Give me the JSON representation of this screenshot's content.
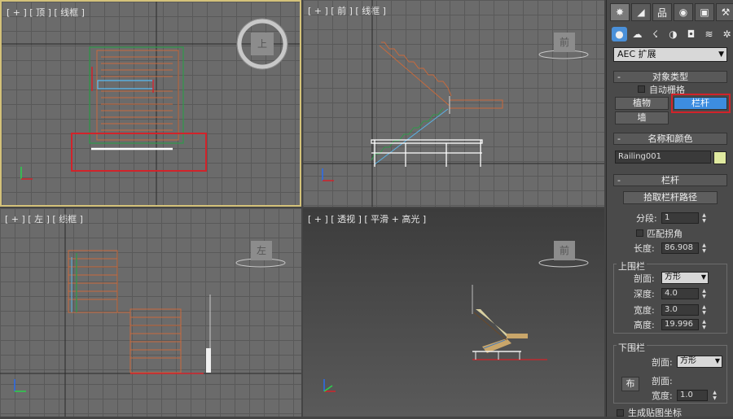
{
  "viewports": {
    "top": {
      "label": "[ + ] [ 顶 ] [ 线框 ]",
      "cube": "上"
    },
    "front": {
      "label": "[ + ] [ 前 ] [ 线框 ]",
      "cube": "前"
    },
    "left": {
      "label": "[ + ] [ 左 ] [ 线框 ]",
      "cube": "左"
    },
    "perspective": {
      "label": "[ + ] [ 透视 ] [ 平滑 + 高光 ]",
      "cube": "前"
    }
  },
  "panel": {
    "tabs": [
      {
        "icon": "create-icon",
        "glyph": "✸"
      },
      {
        "icon": "modify-icon",
        "glyph": "◢"
      },
      {
        "icon": "hierarchy-icon",
        "glyph": "品"
      },
      {
        "icon": "motion-icon",
        "glyph": "◉"
      },
      {
        "icon": "display-icon",
        "glyph": "▣"
      },
      {
        "icon": "utilities-icon",
        "glyph": "⚒"
      }
    ],
    "subtabs": [
      {
        "icon": "geometry-icon",
        "glyph": "●"
      },
      {
        "icon": "shapes-icon",
        "glyph": "☁"
      },
      {
        "icon": "lights-icon",
        "glyph": "☇"
      },
      {
        "icon": "cameras-icon",
        "glyph": "◑"
      },
      {
        "icon": "helpers-icon",
        "glyph": "◘"
      },
      {
        "icon": "spacewarps-icon",
        "glyph": "≋"
      },
      {
        "icon": "systems-icon",
        "glyph": "✲"
      }
    ],
    "category": "AEC 扩展",
    "object_type": {
      "title": "对象类型",
      "auto_grid": "自动栅格",
      "buttons": {
        "plant": "植物",
        "railing": "栏杆",
        "wall": "墙"
      }
    },
    "name_color": {
      "title": "名称和颜色",
      "name": "Railing001",
      "color": "#e0eaa0"
    },
    "railing": {
      "title": "栏杆",
      "pick_path": "拾取栏杆路径",
      "segments_label": "分段:",
      "segments_value": "1",
      "match_corners": "匹配拐角",
      "length_label": "长度:",
      "length_value": "86.908",
      "top_rail": {
        "title": "上围栏",
        "profile_label": "剖面:",
        "profile_value": "方形",
        "depth_label": "深度:",
        "depth_value": "4.0",
        "width_label": "宽度:",
        "width_value": "3.0",
        "height_label": "高度:",
        "height_value": "19.996"
      },
      "lower_rail": {
        "title": "下围栏",
        "profile_label": "剖面:",
        "profile_value": "方形",
        "profile2_label": "剖面:",
        "width_label": "宽度:",
        "width_value": "1.0",
        "frag": "布"
      },
      "gen_mapping": "生成贴图坐标"
    }
  }
}
